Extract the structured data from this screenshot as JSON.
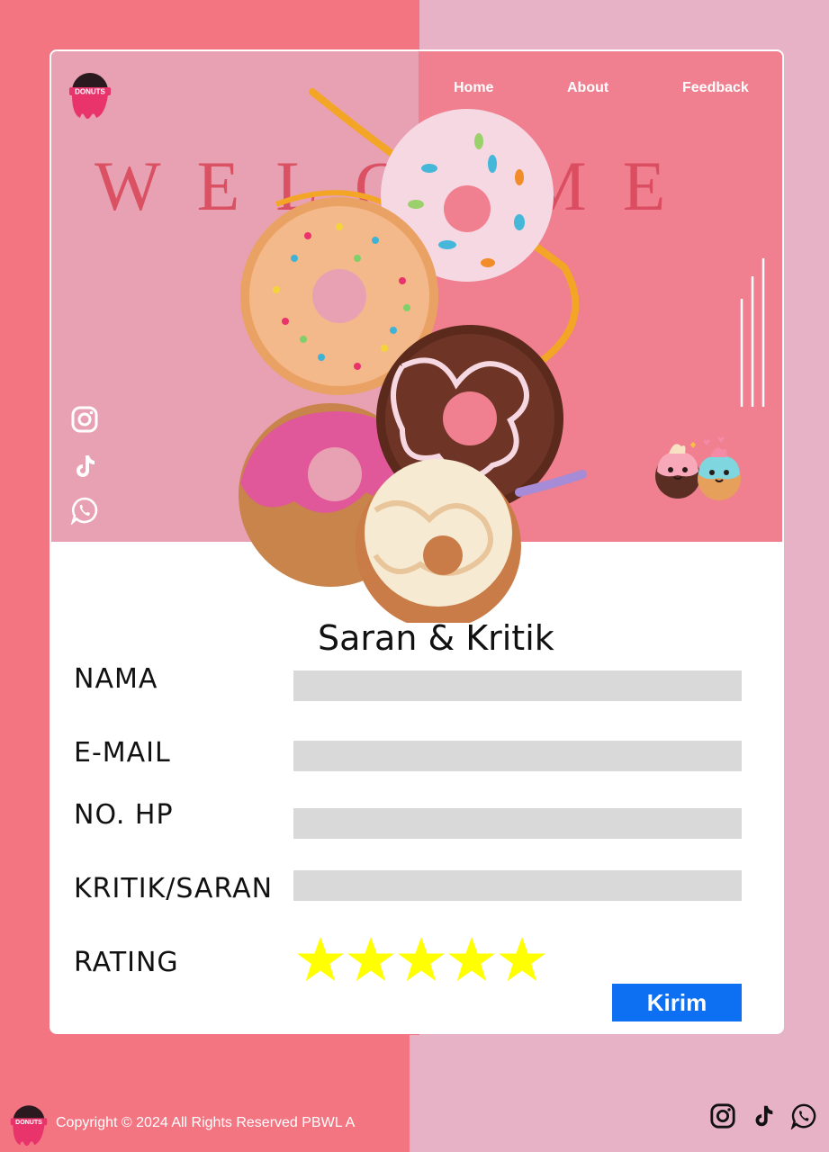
{
  "header": {
    "logo_text": "DONUTS",
    "nav": {
      "home": "Home",
      "about": "About",
      "feedback": "Feedback"
    }
  },
  "hero": {
    "welcome": "WELCOME",
    "social_icons": [
      "instagram-icon",
      "tiktok-icon",
      "whatsapp-icon"
    ]
  },
  "form": {
    "title": "Saran & Kritik",
    "fields": [
      {
        "label": "NAMA",
        "value": "",
        "placeholder": ""
      },
      {
        "label": "E-MAIL",
        "value": "",
        "placeholder": ""
      },
      {
        "label": "NO. HP",
        "value": "",
        "placeholder": ""
      },
      {
        "label": "KRITIK/SARAN",
        "value": "",
        "placeholder": ""
      }
    ],
    "rating_label": "RATING",
    "rating": {
      "value": 5,
      "max": 5
    },
    "submit_label": "Kirim"
  },
  "footer": {
    "logo_text": "DONUTS",
    "copyright": "Copyright © 2024 All Rights Reserved PBWL A",
    "social_icons": [
      "instagram-icon",
      "tiktok-icon",
      "whatsapp-icon"
    ]
  },
  "colors": {
    "left_background": "#f47582",
    "right_background": "#e8b2c6",
    "hero_left": "#e8a1b2",
    "hero_right": "#f07f8f",
    "welcome_text": "#d9475a",
    "field_background": "#d9d9d9",
    "star": "#ffff00",
    "submit_button": "#0d6ff2"
  }
}
